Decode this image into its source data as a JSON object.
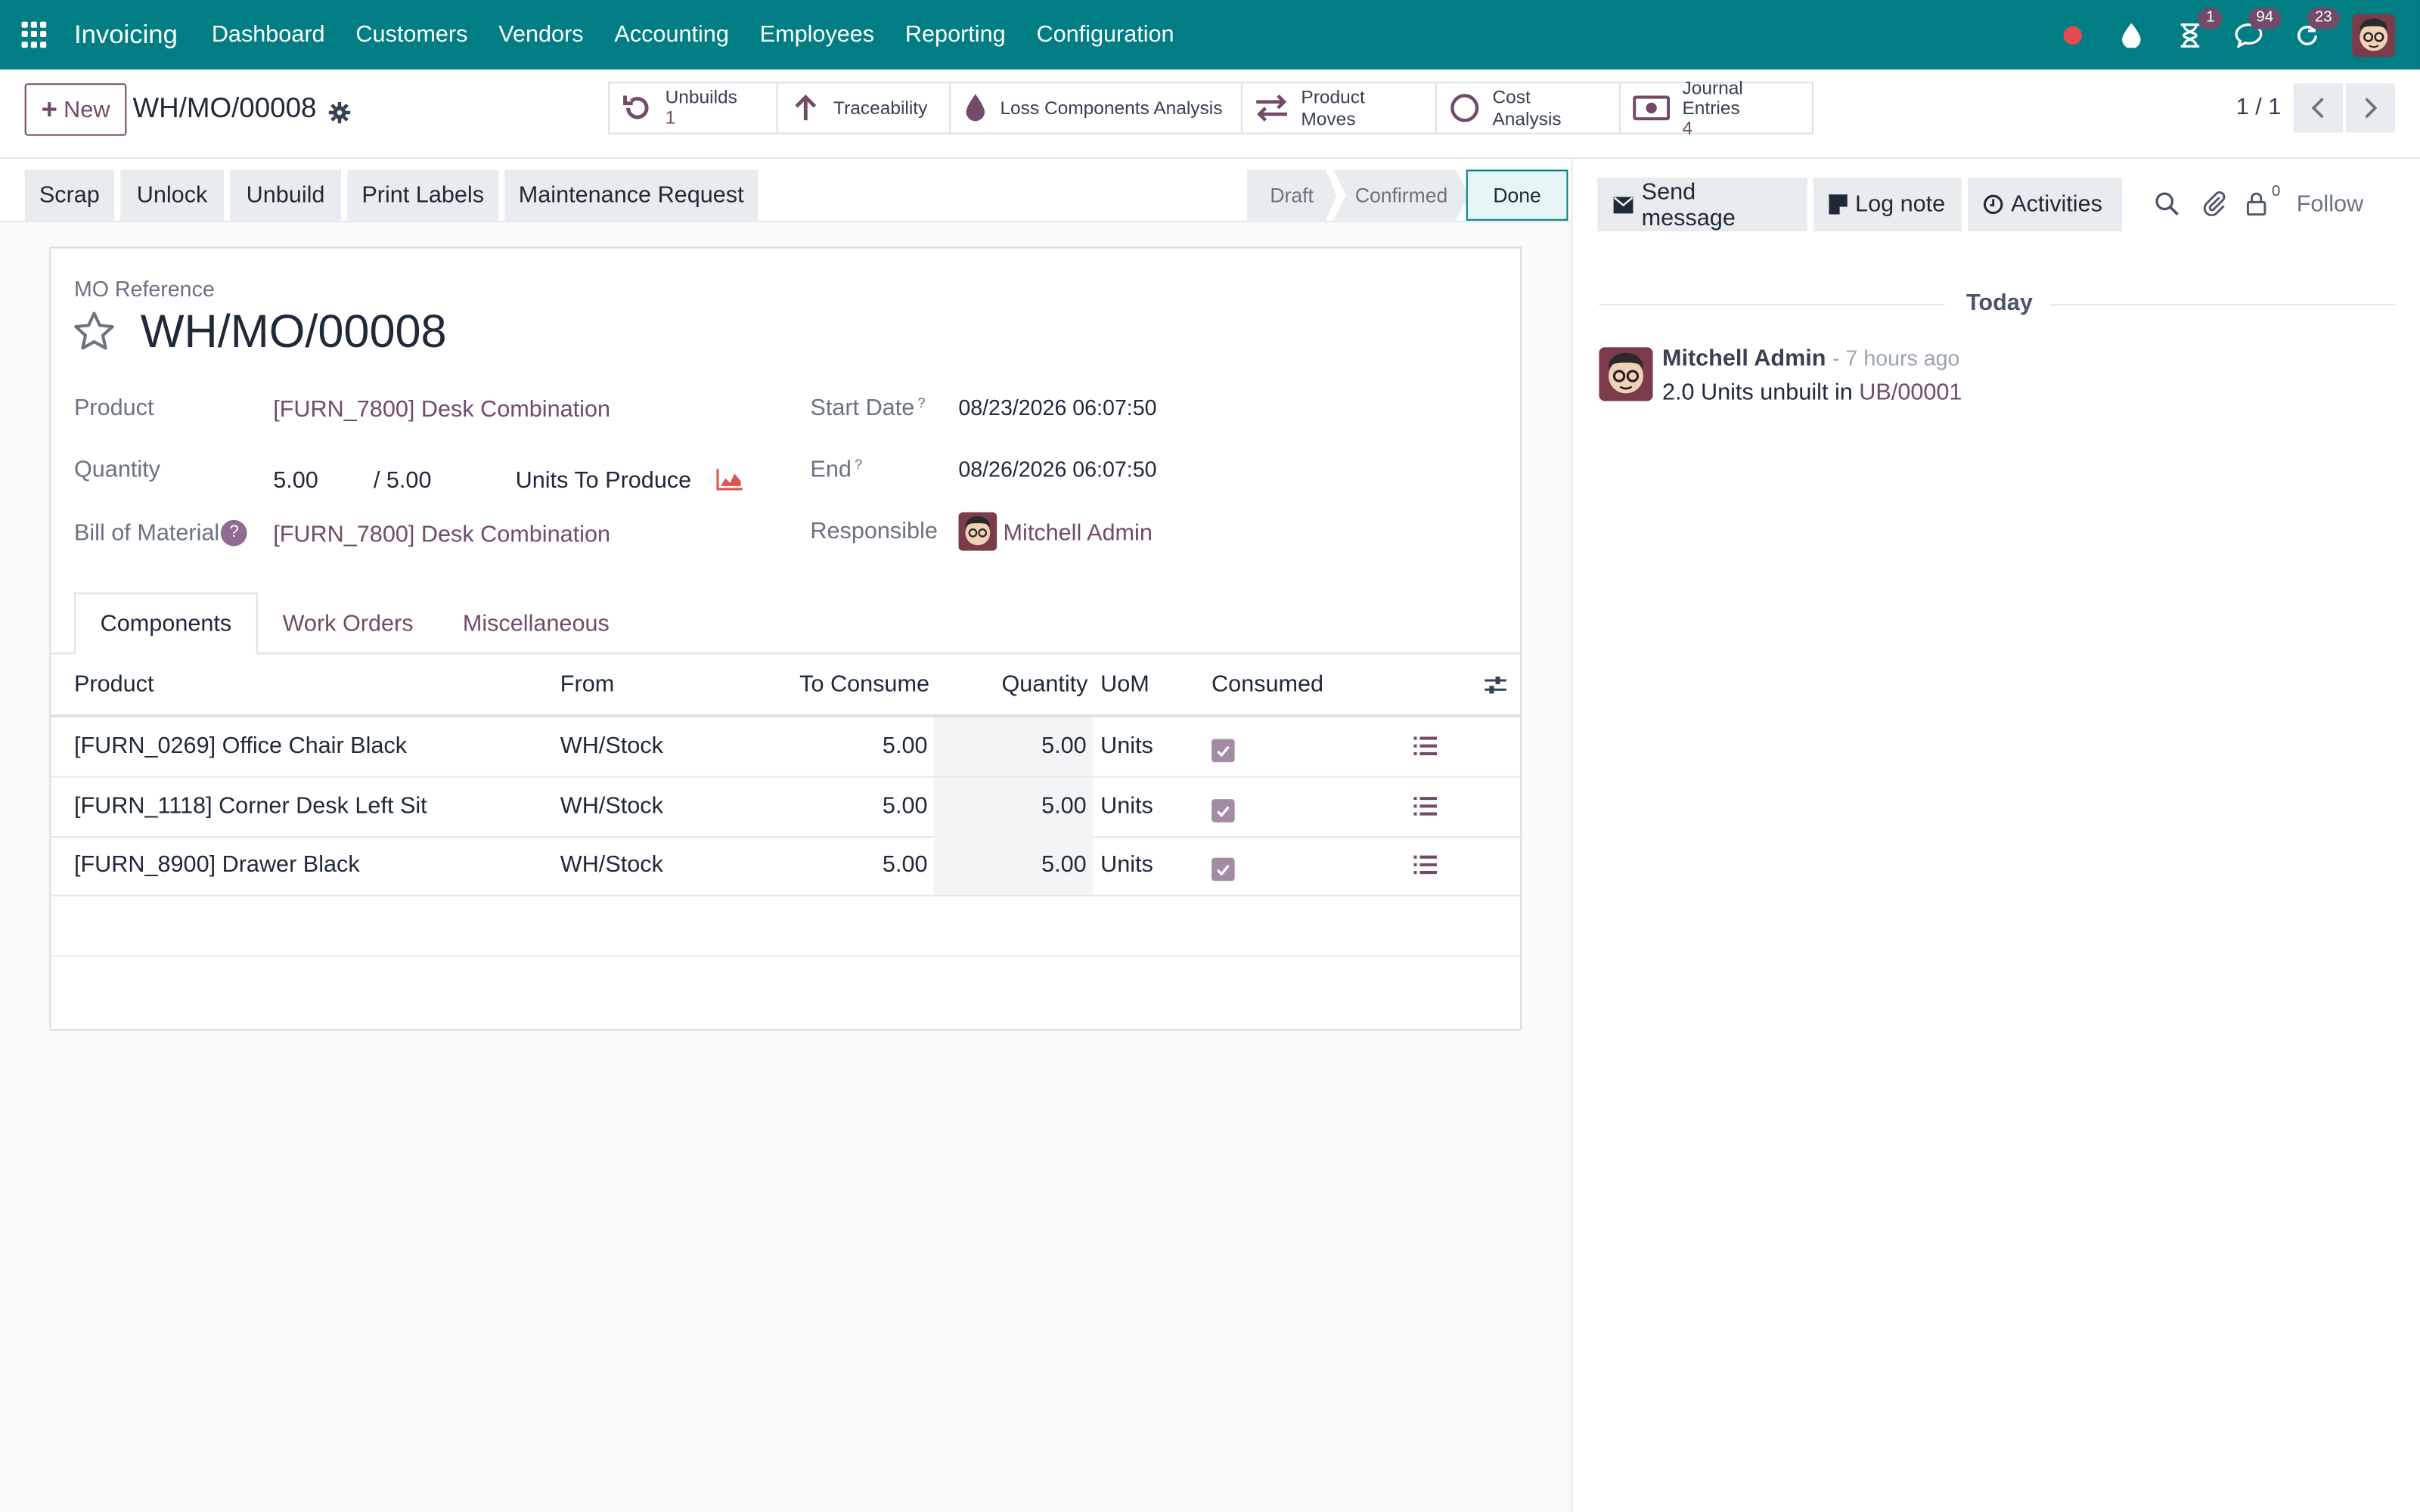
{
  "navbar": {
    "app_name": "Invoicing",
    "menu": [
      "Dashboard",
      "Customers",
      "Vendors",
      "Accounting",
      "Employees",
      "Reporting",
      "Configuration"
    ],
    "badges": {
      "activity": "1",
      "messages": "94",
      "updates": "23"
    },
    "accent": "#017e84"
  },
  "control_panel": {
    "new_label": "New",
    "breadcrumb": "WH/MO/00008",
    "smart_buttons": {
      "unbuilds": {
        "label": "Unbuilds",
        "value": "1"
      },
      "traceability": "Traceability",
      "loss": "Loss Components Analysis",
      "moves": "Product Moves",
      "cost": "Cost Analysis",
      "journal": {
        "label": "Journal Entries",
        "value": "4"
      }
    },
    "pager": "1 / 1"
  },
  "actions": [
    "Scrap",
    "Unlock",
    "Unbuild",
    "Print Labels",
    "Maintenance Request"
  ],
  "stages": [
    "Draft",
    "Confirmed",
    "Done"
  ],
  "form": {
    "mo_ref_label": "MO Reference",
    "mo_ref": "WH/MO/00008",
    "product_label": "Product",
    "product": "[FURN_7800] Desk Combination",
    "quantity_label": "Quantity",
    "qty_produced": "5.00",
    "qty_total": "/ 5.00",
    "qty_uom": "Units To Produce",
    "bom_label": "Bill of Material",
    "bom": "[FURN_7800] Desk Combination",
    "start_label": "Start Date",
    "start": "08/23/2026 06:07:50",
    "end_label": "End",
    "end": "08/26/2026 06:07:50",
    "responsible_label": "Responsible",
    "responsible": "Mitchell Admin"
  },
  "tabs": [
    "Components",
    "Work Orders",
    "Miscellaneous"
  ],
  "components": {
    "headers": {
      "product": "Product",
      "from": "From",
      "to_consume": "To Consume",
      "quantity": "Quantity",
      "uom": "UoM",
      "consumed": "Consumed"
    },
    "rows": [
      {
        "product": "[FURN_0269] Office Chair Black",
        "from": "WH/Stock",
        "to_consume": "5.00",
        "quantity": "5.00",
        "uom": "Units",
        "consumed": true
      },
      {
        "product": "[FURN_1118] Corner Desk Left Sit",
        "from": "WH/Stock",
        "to_consume": "5.00",
        "quantity": "5.00",
        "uom": "Units",
        "consumed": true
      },
      {
        "product": "[FURN_8900] Drawer Black",
        "from": "WH/Stock",
        "to_consume": "5.00",
        "quantity": "5.00",
        "uom": "Units",
        "consumed": true
      }
    ]
  },
  "chatter": {
    "send_message": "Send message",
    "log_note": "Log note",
    "activities": "Activities",
    "followers_count": "0",
    "follow": "Follow",
    "today": "Today",
    "message": {
      "author": "Mitchell Admin",
      "time": "- 7 hours ago",
      "body_prefix": "2.0 Units unbuilt in ",
      "body_link": "UB/00001"
    }
  }
}
